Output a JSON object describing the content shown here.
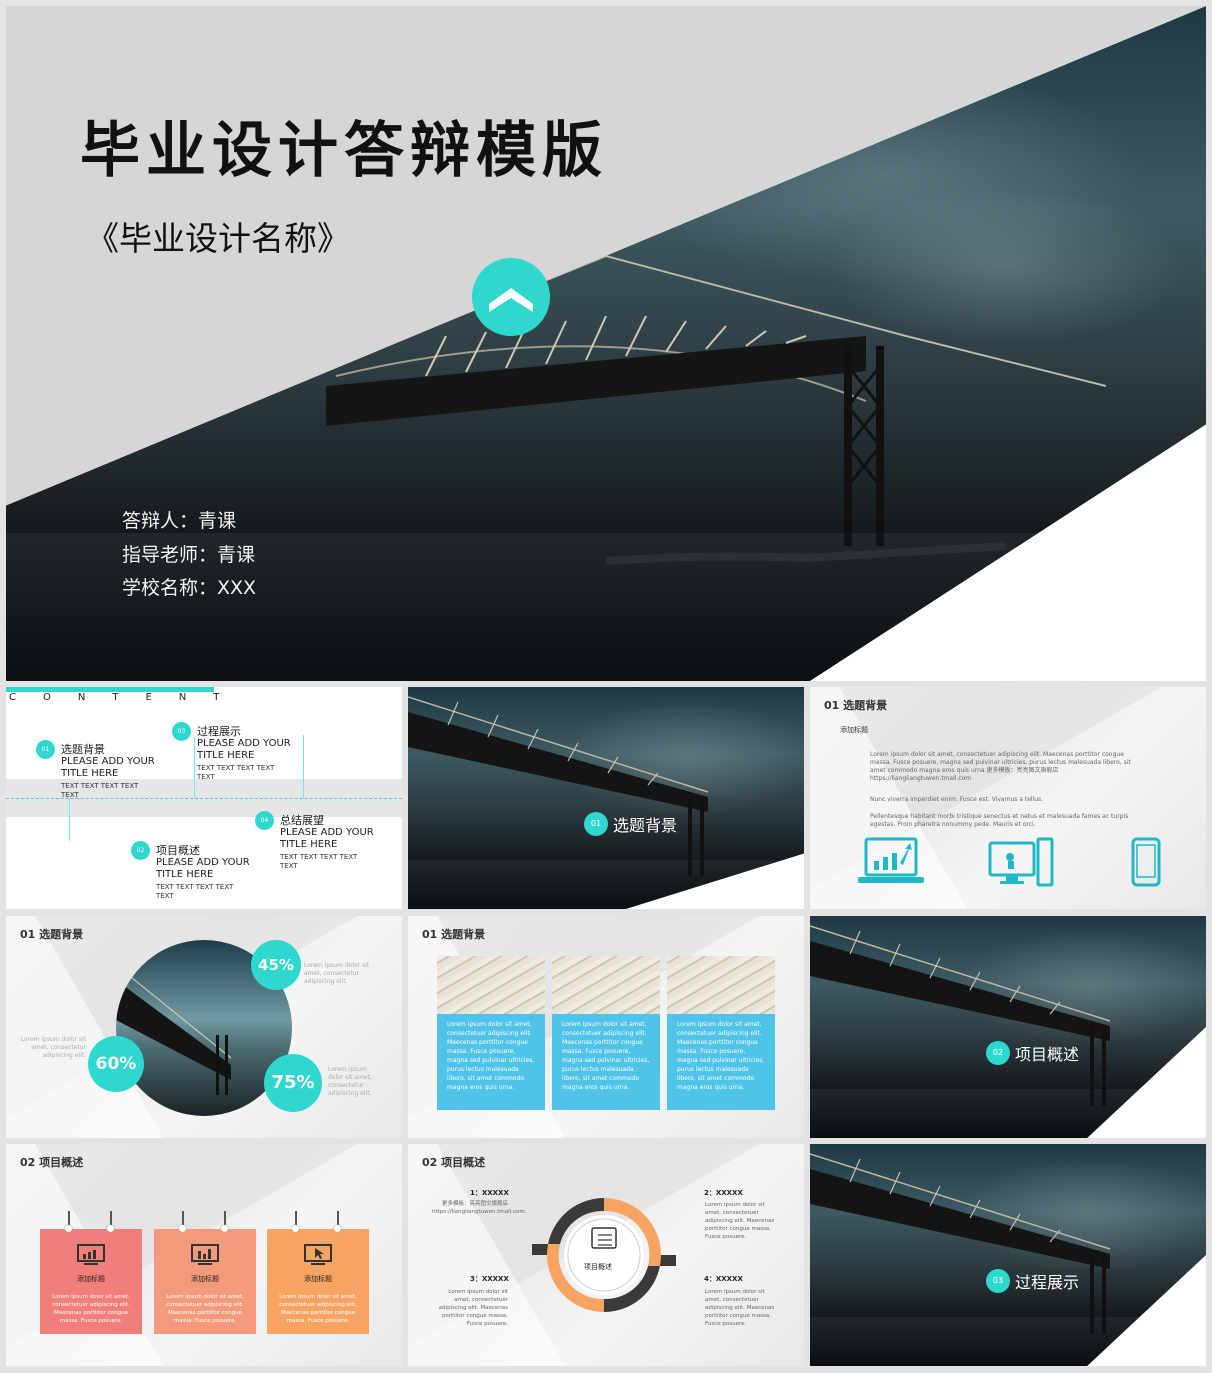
{
  "cover": {
    "title": "毕业设计答辩模版",
    "subtitle": "《毕业设计名称》",
    "presenter": "答辩人：青课",
    "advisor": "指导老师：青课",
    "school": "学校名称：XXX"
  },
  "contents": {
    "heading": "CONTENT",
    "items": [
      {
        "num": "01",
        "title": "选题背景",
        "big": "PLEASE ADD YOUR TITLE HERE",
        "small": "TEXT TEXT TEXT TEXT TEXT"
      },
      {
        "num": "02",
        "title": "项目概述",
        "big": "PLEASE ADD YOUR TITLE HERE",
        "small": "TEXT TEXT TEXT TEXT TEXT"
      },
      {
        "num": "03",
        "title": "过程展示",
        "big": "PLEASE ADD YOUR TITLE HERE",
        "small": "TEXT TEXT TEXT TEXT TEXT"
      },
      {
        "num": "04",
        "title": "总结展望",
        "big": "PLEASE ADD YOUR TITLE HERE",
        "small": "TEXT TEXT TEXT TEXT TEXT"
      }
    ]
  },
  "sections": [
    {
      "num": "01",
      "label": "选题背景"
    },
    {
      "num": "02",
      "label": "项目概述"
    },
    {
      "num": "03",
      "label": "过程展示"
    }
  ],
  "bg_slide": {
    "header": "01 选题背景",
    "subtitle": "添加标题",
    "para1": "Lorem ipsum dolor sit amet, consectetuer adipiscing elit. Maecenas porttitor congue massa. Fusce posuere, magna sed pulvinar ultricies, purus lectus malesuada libero, sit amet commodo magna eros quis urna.更多模板：亮亮图文旗舰店 https://liangliangtuwen.tmall.com",
    "para2": "Nunc viverra imperdiet enim. Fusce est. Vivamus a tellus.",
    "para3": "Pellentesque habitant morbi tristique senectus et netus et malesuada fames ac turpis egestas. Proin pharetra nonummy pede. Mauris et orci.",
    "icons": [
      "laptop-chart-icon",
      "desktop-touch-icon",
      "phone-icon"
    ]
  },
  "stats_slide": {
    "header": "01 选题背景",
    "stats": [
      {
        "value": "45%",
        "text": "Lorem ipsum dolor sit amet, consectetur adipiscing elit."
      },
      {
        "value": "60%",
        "text": "Lorem ipsum dolor sit amet, consectetur adipiscing elit."
      },
      {
        "value": "75%",
        "text": "Lorem ipsum dolor sit amet, consectetur adipiscing elit."
      }
    ]
  },
  "columns_slide": {
    "header": "01 选题背景",
    "columns": [
      "Lorem ipsum dolor sit amet, consectetuer adipiscing elit. Maecenas porttitor congue massa. Fusce posuere, magna sed pulvinar ultricies, purus lectus malesuada libero, sit amet commodo magna eros quis urna.",
      "Lorem ipsum dolor sit amet, consectetuer adipiscing elit. Maecenas porttitor congue massa. Fusce posuere, magna sed pulvinar ultricies, purus lectus malesuada libero, sit amet commodo magna eros quis urna.",
      "Lorem ipsum dolor sit amet, consectetuer adipiscing elit. Maecenas porttitor congue massa. Fusce posuere, magna sed pulvinar ultricies, purus lectus malesuada libero, sit amet commodo magna eros quis urna."
    ]
  },
  "cards_slide": {
    "header": "02 项目概述",
    "cards": [
      {
        "label": "添加标题",
        "text": "Lorem ipsum dolor sit amet, consectetuer adipiscing elit. Maecenas porttitor congue massa. Fusce posuere.",
        "color": "#f07f7a"
      },
      {
        "label": "添加标题",
        "text": "Lorem ipsum dolor sit amet, consectetuer adipiscing elit. Maecenas porttitor congue massa. Fusce posuere.",
        "color": "#f39a7c"
      },
      {
        "label": "添加标题",
        "text": "Lorem ipsum dolor sit amet, consectetuer adipiscing elit. Maecenas porttitor congue massa. Fusce posuere.",
        "color": "#f7a463"
      }
    ]
  },
  "ring_slide": {
    "header": "02 项目概述",
    "center": "项目概述",
    "points": [
      {
        "title": "1：XXXXX",
        "text": "更多模板：亮亮图文旗舰店 https://liangliangtuwen.tmall.com."
      },
      {
        "title": "2：XXXXX",
        "text": "Lorem ipsum dolor sit amet, consectetuer adipiscing elit. Maecenas porttitor congue massa. Fusce posuere."
      },
      {
        "title": "3：XXXXX",
        "text": "Lorem ipsum dolor sit amet, consectetuer adipiscing elit. Maecenas porttitor congue massa. Fusce posuere."
      },
      {
        "title": "4：XXXXX",
        "text": "Lorem ipsum dolor sit amet, consectetuer adipiscing elit. Maecenas porttitor congue massa. Fusce posuere."
      }
    ]
  },
  "colors": {
    "accent": "#2ed8cf",
    "card_blue": "#4fc3e8",
    "ring_orange": "#f7a463",
    "ring_dark": "#3a3a3a"
  }
}
